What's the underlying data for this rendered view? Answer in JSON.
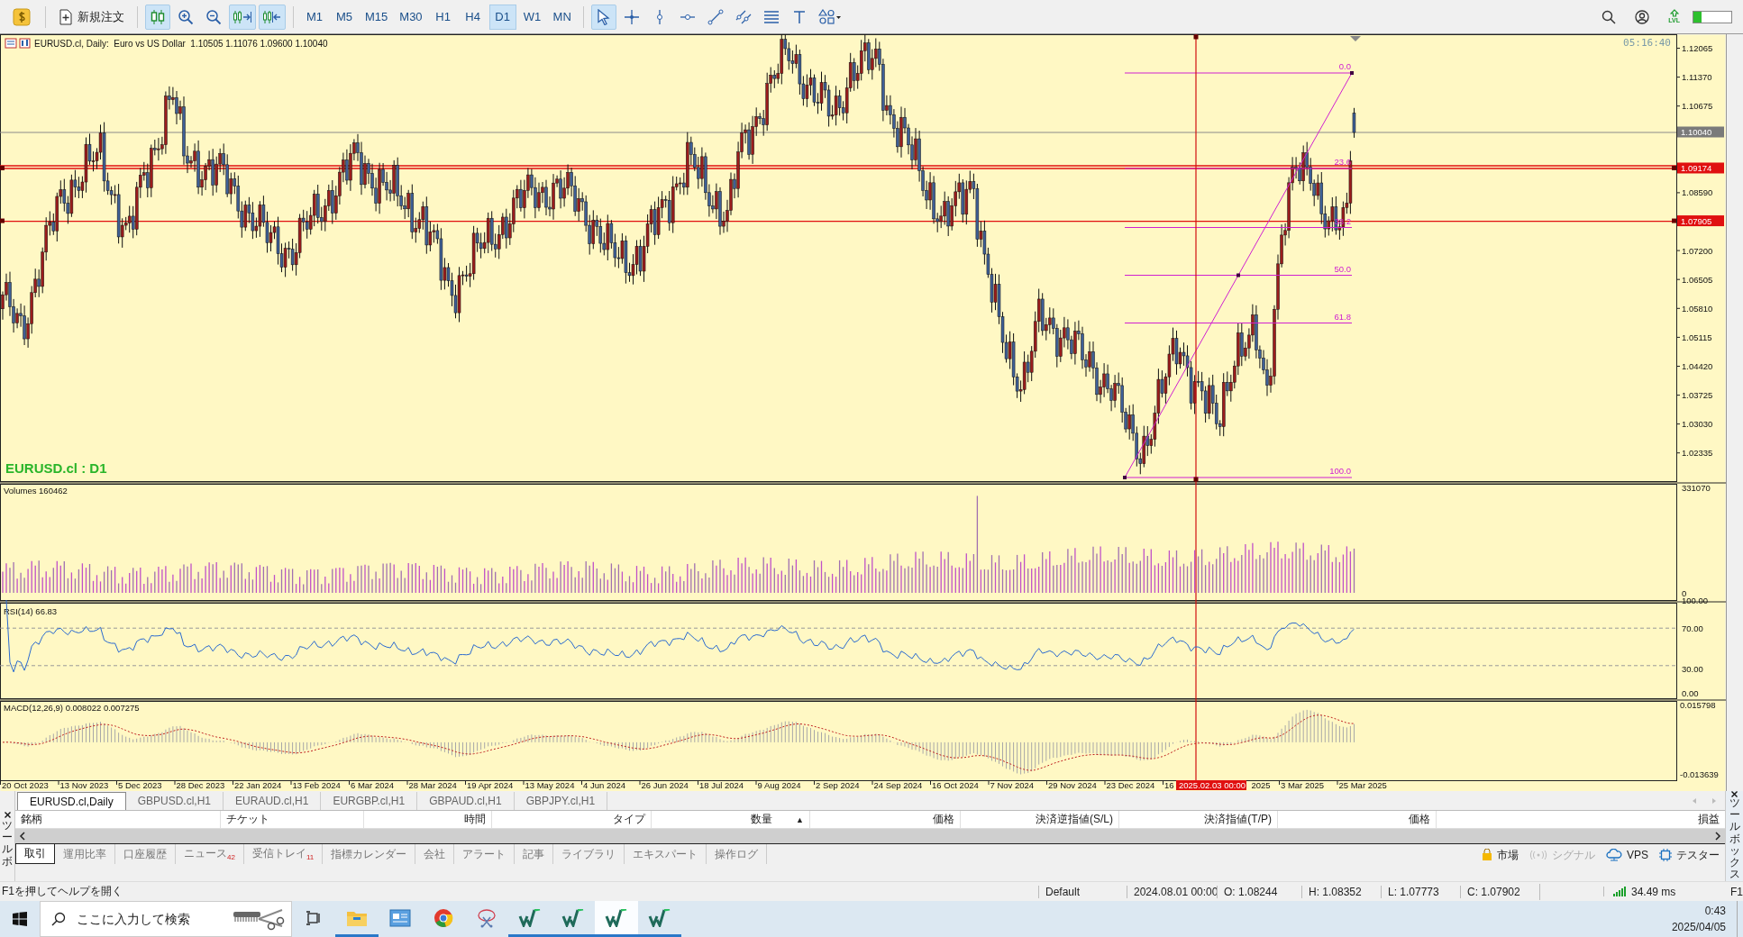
{
  "toolbar": {
    "new_order": "新規注文",
    "tools": [
      {
        "kind": "candles",
        "selected": true
      },
      {
        "kind": "zoom-in",
        "selected": false
      },
      {
        "kind": "zoom-out",
        "selected": false
      },
      {
        "kind": "autoscroll",
        "selected": true
      },
      {
        "kind": "shift",
        "selected": true
      }
    ],
    "timeframes": [
      {
        "label": "M1",
        "selected": false
      },
      {
        "label": "M5",
        "selected": false
      },
      {
        "label": "M15",
        "selected": false
      },
      {
        "label": "M30",
        "selected": false
      },
      {
        "label": "H1",
        "selected": false
      },
      {
        "label": "H4",
        "selected": false
      },
      {
        "label": "D1",
        "selected": true
      },
      {
        "label": "W1",
        "selected": false
      },
      {
        "label": "MN",
        "selected": false
      }
    ],
    "drawing_tools": [
      {
        "kind": "cursor",
        "selected": true
      },
      {
        "kind": "crosshair",
        "selected": false
      },
      {
        "kind": "vline",
        "selected": false
      },
      {
        "kind": "hline",
        "selected": false
      },
      {
        "kind": "trendline",
        "selected": false
      },
      {
        "kind": "channel",
        "selected": false
      },
      {
        "kind": "fibo",
        "selected": false
      },
      {
        "kind": "text",
        "selected": false
      },
      {
        "kind": "shapes",
        "selected": false
      }
    ],
    "level_badge": "LVL",
    "level_meter": {
      "level": 0.22
    }
  },
  "chart": {
    "header": "EURUSD.cl, Daily:  Euro vs US Dollar  1.10505 1.11076 1.09600 1.10040",
    "symbol_label": "EURUSD.cl : D1",
    "server_time": "05:16:40",
    "price_ticks": [
      "1.12065",
      "1.11370",
      "1.10675",
      "1.08590",
      "1.07200",
      "1.06505",
      "1.05810",
      "1.05115",
      "1.04420",
      "1.03725",
      "1.03030",
      "1.02335"
    ],
    "price_markers": [
      {
        "label": "1.10040",
        "kind": "bid"
      },
      {
        "label": "1.09174",
        "kind": "line"
      },
      {
        "label": "1.07905",
        "kind": "line"
      }
    ],
    "fib_levels": [
      "0.0",
      "23.6",
      "38.2",
      "50.0",
      "61.8",
      "100.0"
    ],
    "crosshair_time": "2025.02.03 00:00",
    "time_labels": [
      {
        "label": "20 Oct 2023",
        "kind": "date"
      },
      {
        "label": "13 Nov 2023",
        "kind": "date"
      },
      {
        "label": "5 Dec 2023",
        "kind": "date"
      },
      {
        "label": "28 Dec 2023",
        "kind": "date"
      },
      {
        "label": "22 Jan 2024",
        "kind": "date"
      },
      {
        "label": "13 Feb 2024",
        "kind": "date"
      },
      {
        "label": "6 Mar 2024",
        "kind": "date"
      },
      {
        "label": "28 Mar 2024",
        "kind": "date"
      },
      {
        "label": "19 Apr 2024",
        "kind": "date"
      },
      {
        "label": "13 May 2024",
        "kind": "date"
      },
      {
        "label": "4 Jun 2024",
        "kind": "date"
      },
      {
        "label": "26 Jun 2024",
        "kind": "date"
      },
      {
        "label": "18 Jul 2024",
        "kind": "date"
      },
      {
        "label": "9 Aug 2024",
        "kind": "date"
      },
      {
        "label": "2 Sep 2024",
        "kind": "date"
      },
      {
        "label": "24 Sep 2024",
        "kind": "date"
      },
      {
        "label": "16 Oct 2024",
        "kind": "date"
      },
      {
        "label": "7 Nov 2024",
        "kind": "date"
      },
      {
        "label": "29 Nov 2024",
        "kind": "date"
      },
      {
        "label": "23 Dec 2024",
        "kind": "date"
      },
      {
        "label": "16",
        "kind": "date"
      },
      {
        "label": "2025",
        "kind": "tail"
      },
      {
        "label": "3 Mar 2025",
        "kind": "date"
      },
      {
        "label": "25 Mar 2025",
        "kind": "date"
      }
    ]
  },
  "volume": {
    "title": "Volumes 160462",
    "ticks": [
      "331070",
      "0"
    ]
  },
  "rsi": {
    "title": "RSI(14) 66.83",
    "ticks": [
      "100.00",
      "70.00",
      "30.00",
      "0.00"
    ]
  },
  "macd": {
    "title": "MACD(12,26,9) 0.008022 0.007275",
    "ticks": [
      "0.015798",
      "-0.013639"
    ]
  },
  "symbol_tabs": [
    {
      "label": "EURUSD.cl,Daily",
      "selected": true
    },
    {
      "label": "GBPUSD.cl,H1",
      "selected": false
    },
    {
      "label": "EURAUD.cl,H1",
      "selected": false
    },
    {
      "label": "EURGBP.cl,H1",
      "selected": false
    },
    {
      "label": "GBPAUD.cl,H1",
      "selected": false
    },
    {
      "label": "GBPJPY.cl,H1",
      "selected": false
    }
  ],
  "terminal": {
    "columns": [
      {
        "label": "銘柄"
      },
      {
        "label": "チケット"
      },
      {
        "label": "時間"
      },
      {
        "label": "タイプ"
      },
      {
        "label": "数量",
        "sort_mark": "▲"
      },
      {
        "label": "価格"
      },
      {
        "label": "決済逆指値(S/L)"
      },
      {
        "label": "決済指値(T/P)"
      },
      {
        "label": "価格"
      },
      {
        "label": "損益"
      }
    ],
    "tabs": [
      {
        "label": "取引",
        "selected": true
      },
      {
        "label": "運用比率",
        "selected": false
      },
      {
        "label": "口座履歴",
        "selected": false
      },
      {
        "label": "ニュース",
        "badge": "42",
        "selected": false
      },
      {
        "label": "受信トレイ",
        "badge": "11",
        "selected": false
      },
      {
        "label": "指標カレンダー",
        "selected": false
      },
      {
        "label": "会社",
        "selected": false
      },
      {
        "label": "アラート",
        "selected": false
      },
      {
        "label": "記事",
        "selected": false
      },
      {
        "label": "ライブラリ",
        "selected": false
      },
      {
        "label": "エキスパート",
        "selected": false
      },
      {
        "label": "操作ログ",
        "selected": false
      }
    ],
    "services": [
      {
        "label": "市場",
        "kind": "market",
        "disabled": false
      },
      {
        "label": "シグナル",
        "kind": "signal",
        "disabled": true
      },
      {
        "label": "VPS",
        "kind": "vps",
        "disabled": false
      },
      {
        "label": "テスター",
        "kind": "tester",
        "disabled": false
      }
    ],
    "side_label_left": "ツールボ",
    "side_label_right": "ツールボックス"
  },
  "status_bar": {
    "help": "F1を押してヘルプを開く",
    "profile": "Default",
    "time": "2024.08.01 00:00",
    "open": "O: 1.08244",
    "high": "H: 1.08352",
    "low": "L: 1.07773",
    "close": "C: 1.07902",
    "ping": "34.49 ms",
    "edge": "F1"
  },
  "taskbar": {
    "search_placeholder": "ここに入力して検索",
    "apps": [
      {
        "kind": "taskview",
        "active": false,
        "selected": false
      },
      {
        "kind": "explorer",
        "active": true,
        "selected": false
      },
      {
        "kind": "app",
        "active": false,
        "selected": false
      },
      {
        "kind": "browser",
        "active": false,
        "selected": false
      },
      {
        "kind": "snip",
        "active": false,
        "selected": false
      },
      {
        "kind": "trader",
        "active": true,
        "selected": false
      },
      {
        "kind": "trader",
        "active": true,
        "selected": false
      },
      {
        "kind": "trader",
        "active": true,
        "selected": true
      },
      {
        "kind": "trader",
        "active": true,
        "selected": false
      }
    ],
    "time": "0:43",
    "date": "2025/04/05"
  }
}
